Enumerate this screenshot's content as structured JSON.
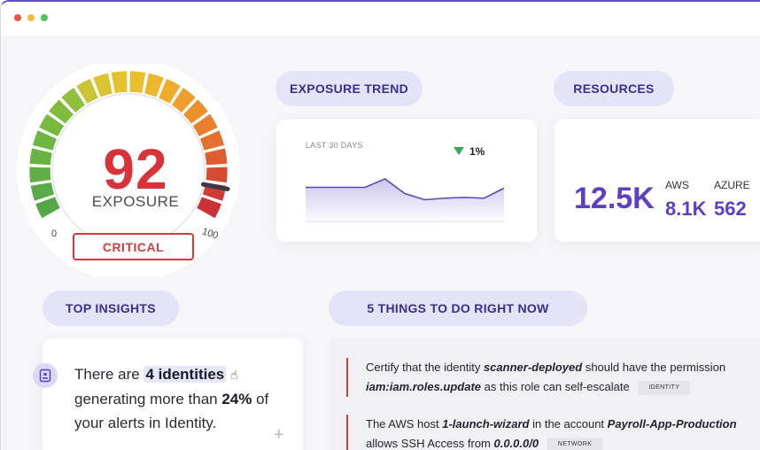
{
  "gauge": {
    "score": "92",
    "label": "EXPOSURE",
    "severity": "CRITICAL",
    "min": "0",
    "max": "100",
    "level_fraction": 0.92
  },
  "trend": {
    "pill_label": "EXPOSURE TREND",
    "subtitle": "LAST 30 DAYS",
    "change": "1%",
    "direction": "down",
    "values": [
      44,
      44,
      44,
      44,
      55,
      36,
      28,
      30,
      31,
      30,
      43
    ]
  },
  "resources": {
    "pill_label": "RESOURCES",
    "total": "12.5K",
    "aws_label": "AWS",
    "aws_value": "8.1K",
    "azure_label": "AZURE",
    "azure_value": "562"
  },
  "insights": {
    "pill_label": "TOP INSIGHTS",
    "text_prefix": "There are ",
    "highlight": "4 identities",
    "text_mid": "generating more than ",
    "percent": "24%",
    "text_suffix": " of",
    "text_end": "your alerts in Identity.",
    "add_symbol": "+"
  },
  "todo": {
    "pill_label": "5 THINGS TO DO RIGHT NOW",
    "items": [
      {
        "part1": "Certify that the identity ",
        "bold1": "scanner-deployed",
        "part2": " should have the permission",
        "bold2": "iam:iam.roles.update",
        "part3": " as this role can self-escalate",
        "tag": "IDENTITY"
      },
      {
        "part1": "The AWS host ",
        "bold1": "1-launch-wizard",
        "part2": " in the account ",
        "bold2": "Payroll-App-Production",
        "part3": "allows SSH Access from ",
        "bold3": "0.0.0.0/0",
        "tag": "NETWORK"
      }
    ]
  },
  "colors": {
    "accent": "#5b3fc4",
    "critical": "#d43a3f",
    "pill_bg": "#e4e3f8",
    "trend_up_arrow": "#3aa55c"
  }
}
